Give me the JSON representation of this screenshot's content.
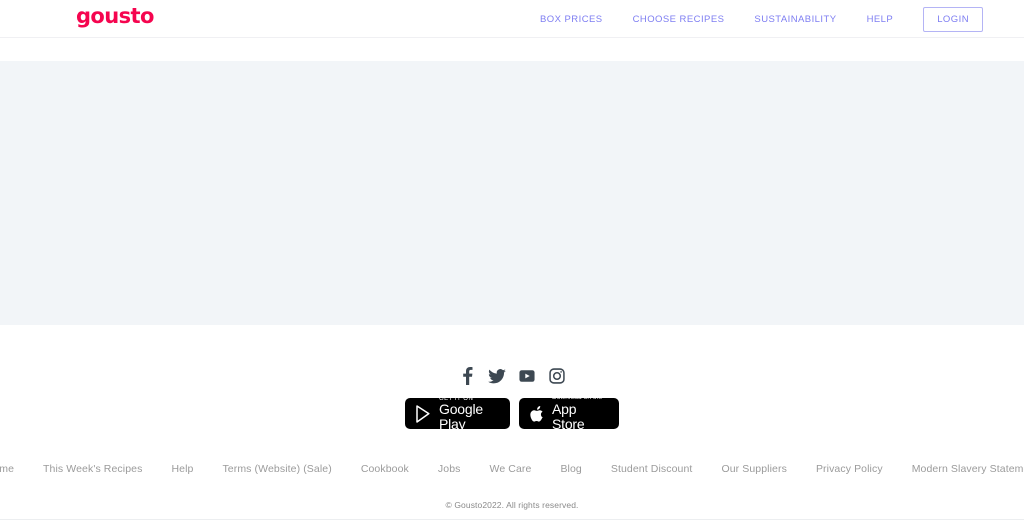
{
  "header": {
    "logo_text": "gousto",
    "logo_color": "#f5054f",
    "nav_link_color": "#7e7ef2",
    "nav_items": [
      {
        "label": "BOX PRICES",
        "name": "nav-box-prices"
      },
      {
        "label": "CHOOSE RECIPES",
        "name": "nav-choose-recipes"
      },
      {
        "label": "SUSTAINABILITY",
        "name": "nav-sustainability"
      },
      {
        "label": "HELP",
        "name": "nav-help"
      }
    ],
    "login_label": "LOGIN"
  },
  "hero": {
    "background_color": "#f2f5f8",
    "content": ""
  },
  "footer": {
    "social": [
      {
        "label": "Facebook",
        "icon": "facebook-icon"
      },
      {
        "label": "Twitter",
        "icon": "twitter-icon"
      },
      {
        "label": "YouTube",
        "icon": "youtube-icon"
      },
      {
        "label": "Instagram",
        "icon": "instagram-icon"
      }
    ],
    "stores": {
      "google": {
        "top": "GET IT ON",
        "bottom": "Google Play"
      },
      "apple": {
        "top": "Download on the",
        "bottom": "App Store"
      }
    },
    "links": [
      {
        "label": "Home",
        "name": "footer-link-home"
      },
      {
        "label": "This Week's Recipes",
        "name": "footer-link-this-weeks-recipes"
      },
      {
        "label": "Help",
        "name": "footer-link-help"
      },
      {
        "label": "Terms (Website) (Sale)",
        "name": "footer-link-terms"
      },
      {
        "label": "Cookbook",
        "name": "footer-link-cookbook"
      },
      {
        "label": "Jobs",
        "name": "footer-link-jobs"
      },
      {
        "label": "We Care",
        "name": "footer-link-we-care"
      },
      {
        "label": "Blog",
        "name": "footer-link-blog"
      },
      {
        "label": "Student Discount",
        "name": "footer-link-student-discount"
      },
      {
        "label": "Our Suppliers",
        "name": "footer-link-our-suppliers"
      },
      {
        "label": "Privacy Policy",
        "name": "footer-link-privacy-policy"
      },
      {
        "label": "Modern Slavery Statement",
        "name": "footer-link-modern-slavery-statement"
      }
    ],
    "copyright": "© Gousto2022. All rights reserved."
  }
}
